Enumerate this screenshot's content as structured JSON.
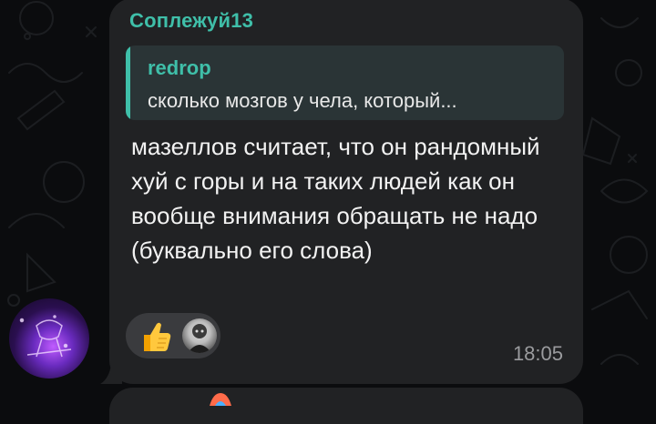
{
  "message": {
    "sender": "Соплежуй13",
    "reply": {
      "author": "redrop",
      "text": "сколько мозгов у чела, который..."
    },
    "text": "мазеллов считает, что он рандомный хуй с горы и на таких людей как он вообще внимания обращать не надо (буквально его слова)",
    "time": "18:05",
    "reactions": [
      {
        "emoji": "thumbs-up-icon",
        "reactor": "user-avatar"
      }
    ]
  },
  "colors": {
    "accent": "#3fbfa9",
    "bubble": "#212224",
    "background": "#0b0c0e",
    "text": "#f2f2f2",
    "muted": "#9a9b9e"
  }
}
